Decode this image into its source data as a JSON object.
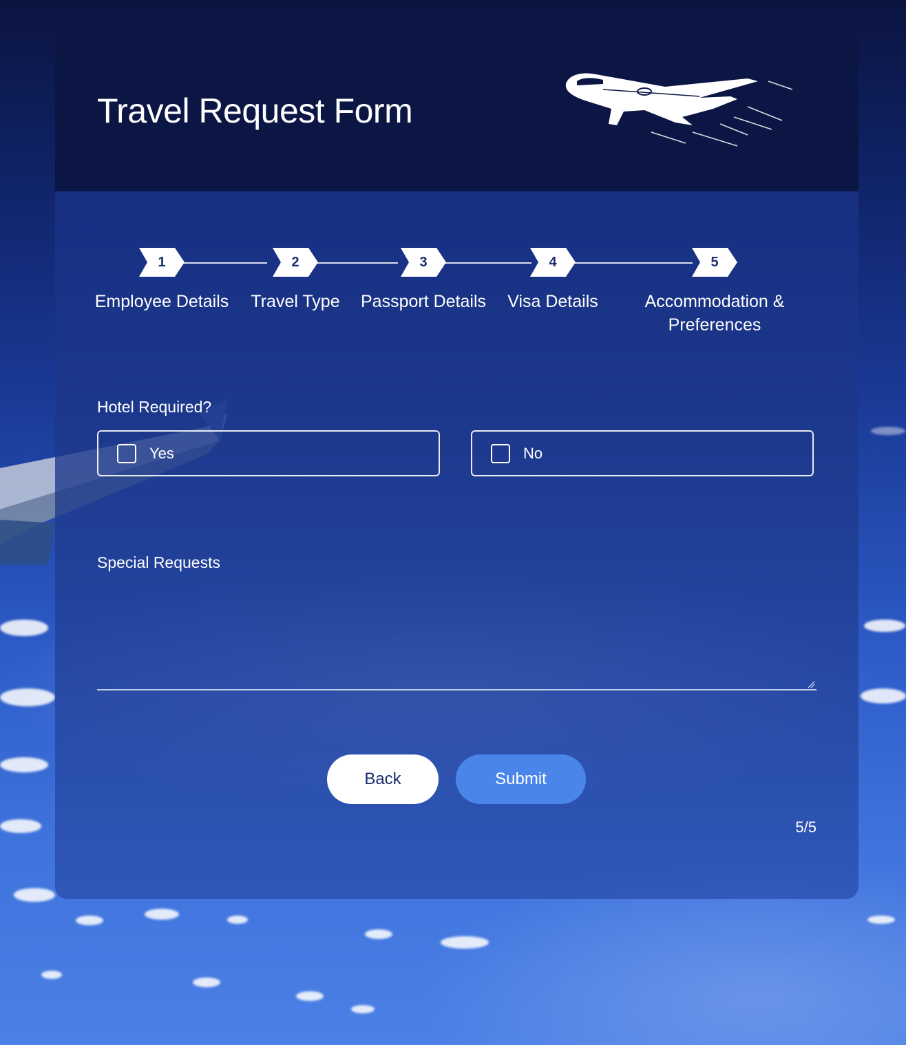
{
  "header": {
    "title": "Travel Request Form"
  },
  "stepper": {
    "current_step": 5,
    "steps": [
      {
        "number": "1",
        "label": "Employee Details"
      },
      {
        "number": "2",
        "label": "Travel Type"
      },
      {
        "number": "3",
        "label": "Passport Details"
      },
      {
        "number": "4",
        "label": "Visa Details"
      },
      {
        "number": "5",
        "label": "Accommodation & Preferences"
      }
    ]
  },
  "hotel": {
    "label": "Hotel Required?",
    "options": [
      {
        "label": "Yes",
        "checked": false
      },
      {
        "label": "No",
        "checked": false
      }
    ]
  },
  "special_requests": {
    "label": "Special Requests",
    "value": ""
  },
  "buttons": {
    "back": "Back",
    "submit": "Submit"
  },
  "pagination": {
    "text": "5/5"
  },
  "colors": {
    "header_bg": "#0c1645",
    "submit_bg": "#4a86ea",
    "step_text": "#1a2d6e"
  }
}
